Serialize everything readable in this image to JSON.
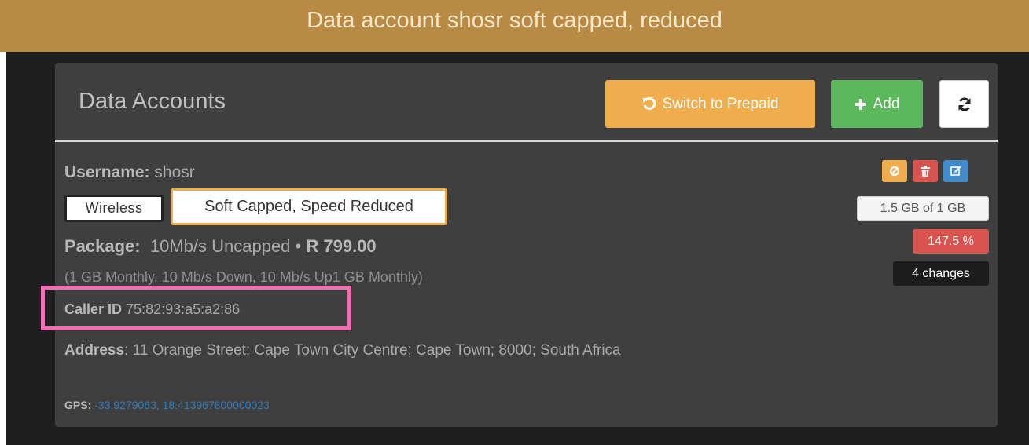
{
  "banner": {
    "text": "Data account shosr soft capped, reduced"
  },
  "panel": {
    "title": "Data Accounts",
    "buttons": {
      "switch_prepaid": "Switch to Prepaid",
      "add": "Add"
    }
  },
  "account": {
    "username_label": "Username:",
    "username": "shosr",
    "type_tag": "Wireless",
    "status_tag": "Soft Capped, Speed Reduced",
    "package_label": "Package:",
    "package_name": "10Mb/s Uncapped •",
    "package_price": "R 799.00",
    "details": "(1 GB Monthly, 10 Mb/s Down, 10 Mb/s Up1 GB Monthly)",
    "caller_id_label": "Caller ID",
    "caller_id": "75:82:93:a5:a2:86",
    "address_label": "Address",
    "address": ": 11 Orange Street; Cape Town City Centre; Cape Town; 8000; South Africa",
    "gps_label": "GPS:",
    "gps": "-33.9279063, 18.413967800000023"
  },
  "stats": {
    "usage": "1.5 GB of 1 GB",
    "percent": "147.5 %",
    "changes": "4 changes"
  },
  "colors": {
    "banner": "#b88a44",
    "warning": "#f0ad4e",
    "success": "#5cb85c",
    "danger": "#d9534f",
    "primary": "#428bca",
    "highlight": "#ef6fb4"
  },
  "icons": {
    "prepaid": "undo-icon",
    "add": "plus-icon",
    "refresh": "refresh-icon",
    "disable": "ban-icon",
    "delete": "trash-icon",
    "edit": "edit-icon"
  }
}
